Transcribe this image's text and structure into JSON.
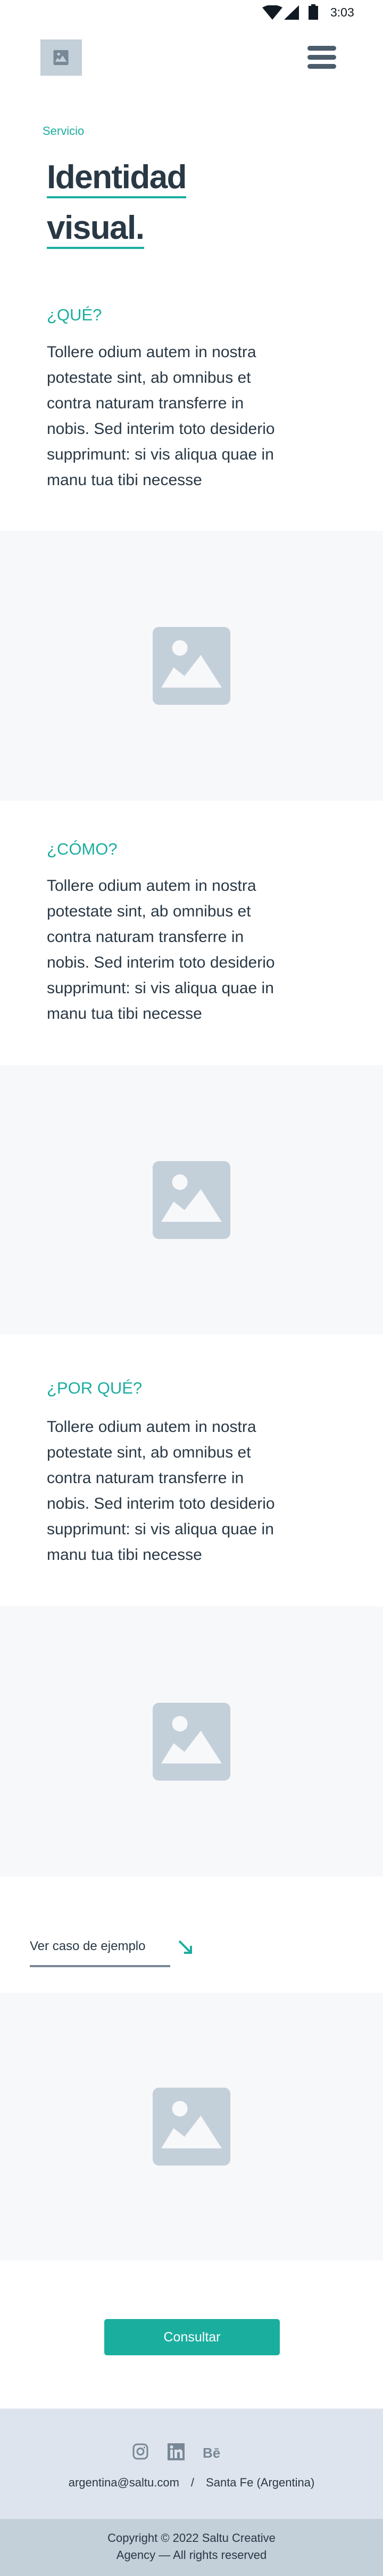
{
  "status_bar": {
    "time": "3:03"
  },
  "header": {
    "logo_icon": "image-placeholder-icon",
    "menu_icon": "hamburger-menu-icon"
  },
  "hero": {
    "eyebrow": "Servicio",
    "title_lines": [
      "Identidad",
      "visual."
    ]
  },
  "sections": [
    {
      "heading": "¿QUÉ?",
      "body_lines": [
        "Tollere odium autem in nostra",
        "potestate sint, ab omnibus et",
        "contra naturam transferre in",
        "nobis. Sed interim toto desiderio",
        "supprimunt: si vis aliqua quae in",
        "manu tua tibi necesse"
      ]
    },
    {
      "heading": "¿CÓMO?",
      "body_lines": [
        "Tollere odium autem in nostra",
        "potestate sint, ab omnibus et",
        "contra naturam transferre in",
        "nobis. Sed interim toto desiderio",
        "supprimunt: si vis aliqua quae in",
        "manu tua tibi necesse"
      ]
    },
    {
      "heading": "¿POR QUÉ?",
      "body_lines": [
        "Tollere odium autem in nostra",
        "potestate sint, ab omnibus et",
        "contra naturam transferre in",
        "nobis. Sed interim toto desiderio",
        "supprimunt: si vis aliqua quae in",
        "manu tua tibi necesse"
      ]
    }
  ],
  "case_link": {
    "label": "Ver caso de ejemplo",
    "icon": "arrow-down-right-icon"
  },
  "cta": {
    "label": "Consultar"
  },
  "footer": {
    "social": [
      "instagram-icon",
      "linkedin-icon",
      "behance-icon"
    ],
    "email": "argentina@saltu.com",
    "separator": "/",
    "location": "Santa Fe (Argentina)",
    "copyright_lines": [
      "Copyright © 2022 Saltu Creative",
      "Agency — All rights reserved"
    ]
  },
  "colors": {
    "accent": "#1aae9f",
    "text": "#293845",
    "placeholder_bg": "#f7f8fa",
    "placeholder_icon": "#c3cfd9",
    "footer_bg": "#dee4ed",
    "copyright_bg": "#c3cfd9"
  }
}
